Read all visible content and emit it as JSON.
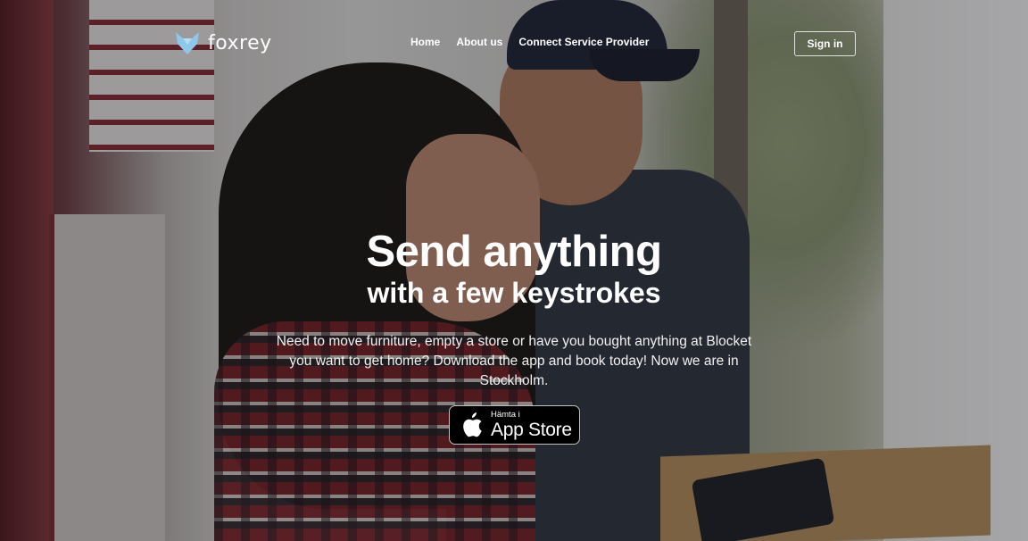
{
  "brand": {
    "name": "foxrey"
  },
  "nav": {
    "items": [
      {
        "label": "Home"
      },
      {
        "label": "About us"
      },
      {
        "label": "Connect Service Provider"
      }
    ],
    "signin_label": "Sign in"
  },
  "hero": {
    "headline": "Send anything",
    "subheadline": "with a few keystrokes",
    "description": "Need to move furniture, empty a store or have you bought anything at Blocket you want to get home? Download the app and book today! Now we are in Stockholm.",
    "appstore": {
      "small": "Hämta i",
      "big": "App Store"
    }
  },
  "colors": {
    "logo_fox": "#8ec7ea",
    "text": "#ffffff",
    "badge_bg": "#000000"
  },
  "icons": {
    "logo": "fox-icon",
    "store": "apple-icon"
  }
}
